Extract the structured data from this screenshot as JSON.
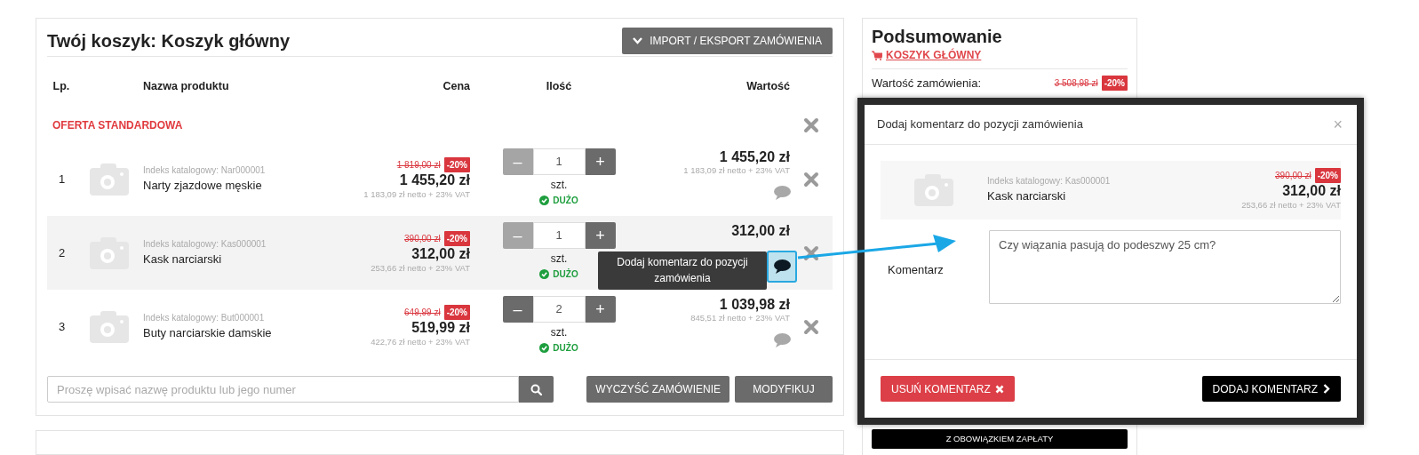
{
  "cart": {
    "title": "Twój koszyk: Koszyk główny",
    "import_button": "IMPORT / EKSPORT ZAMÓWIENIA",
    "columns": [
      "Lp.",
      "Nazwa produktu",
      "Cena",
      "Ilość",
      "Wartość"
    ],
    "section": "OFERTA STANDARDOWA",
    "rows": [
      {
        "lp": "1",
        "index": "Indeks katalogowy: Nar000001",
        "name": "Narty zjazdowe męskie",
        "old_price": "1 819,00 zł",
        "discount": "-20%",
        "price": "1 455,20 zł",
        "price_net": "1 183,09 zł netto + 23% VAT",
        "decrease": "–",
        "quantity": "1",
        "increase": "+",
        "minus_disabled": true,
        "unit": "szt.",
        "stock": "DUŻO",
        "value": "1 455,20 zł",
        "value_net": "1 183,09 zł netto + 23% VAT",
        "selected": false,
        "comment_active": false
      },
      {
        "lp": "2",
        "index": "Indeks katalogowy: Kas000001",
        "name": "Kask narciarski",
        "old_price": "390,00 zł",
        "discount": "-20%",
        "price": "312,00 zł",
        "price_net": "253,66 zł netto + 23% VAT",
        "decrease": "–",
        "quantity": "1",
        "increase": "+",
        "minus_disabled": true,
        "unit": "szt.",
        "stock": "DUŻO",
        "value": "312,00 zł",
        "selected": true,
        "comment_active": true,
        "tooltip": "Dodaj komentarz do pozycji zamówienia"
      },
      {
        "lp": "3",
        "index": "Indeks katalogowy: But000001",
        "name": "Buty narciarskie damskie",
        "old_price": "649,99 zł",
        "discount": "-20%",
        "price": "519,99 zł",
        "price_net": "422,76 zł netto + 23% VAT",
        "decrease": "–",
        "quantity": "2",
        "increase": "+",
        "minus_disabled": false,
        "unit": "szt.",
        "stock": "DUŻO",
        "value": "1 039,98 zł",
        "value_net": "845,51 zł netto + 23% VAT",
        "selected": false,
        "comment_active": false
      }
    ],
    "search": {
      "placeholder": "Proszę wpisać nazwę produktu lub jego numer"
    },
    "buttons": [
      "WYCZYŚĆ ZAMÓWIENIE",
      "MODYFIKUJ"
    ]
  },
  "summary": {
    "title": "Podsumowanie",
    "cart_link": "KOSZYK GŁÓWNY",
    "order_value_label": "Wartość zamówienia:",
    "order_value_old": "3 508,98 zł",
    "order_value_discount": "-20%",
    "pay_button": "Z OBOWIĄZKIEM ZAPŁATY"
  },
  "modal": {
    "title": "Dodaj komentarz do pozycji zamówienia",
    "close": "×",
    "product": {
      "index": "Indeks katalogowy: Kas000001",
      "name": "Kask narciarski",
      "old_price": "390,00 zł",
      "discount": "-20%",
      "price": "312,00 zł",
      "price_net": "253,66 zł netto + 23% VAT"
    },
    "comment_label": "Komentarz",
    "comment": "Czy wiązania pasują do podeszwy 25 cm?",
    "remove_button": "USUŃ KOMENTARZ",
    "add_button": "DODAJ KOMENTARZ"
  }
}
